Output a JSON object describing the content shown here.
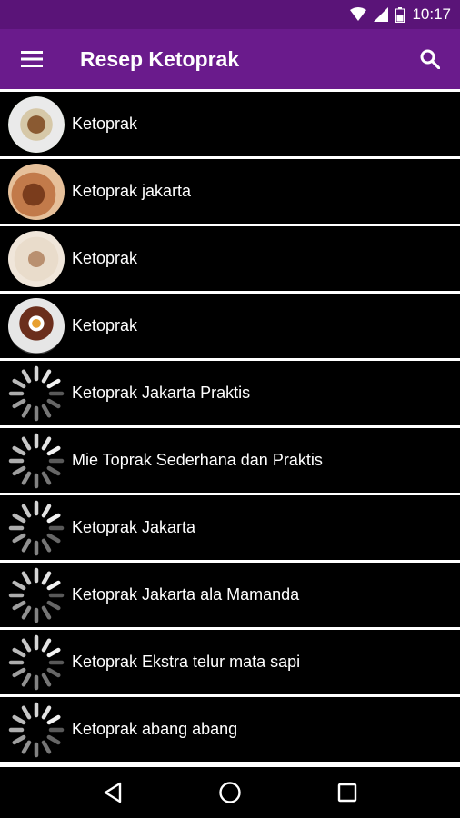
{
  "status_bar": {
    "time": "10:17",
    "icons": [
      "wifi-icon",
      "signal-icon",
      "battery-icon"
    ]
  },
  "app_bar": {
    "title": "Resep Ketoprak",
    "menu_icon": "hamburger-menu-icon",
    "search_icon": "search-icon",
    "color": "#6a1b8c",
    "status_color": "#5a1478"
  },
  "recipes": [
    {
      "label": "Ketoprak",
      "thumbnail": "food-image"
    },
    {
      "label": "Ketoprak jakarta",
      "thumbnail": "food-image"
    },
    {
      "label": "Ketoprak",
      "thumbnail": "food-image"
    },
    {
      "label": "Ketoprak",
      "thumbnail": "food-image"
    },
    {
      "label": "Ketoprak Jakarta Praktis",
      "thumbnail": "loading-spinner"
    },
    {
      "label": "Mie Toprak Sederhana dan Praktis",
      "thumbnail": "loading-spinner"
    },
    {
      "label": "Ketoprak Jakarta",
      "thumbnail": "loading-spinner"
    },
    {
      "label": "Ketoprak Jakarta ala Mamanda",
      "thumbnail": "loading-spinner"
    },
    {
      "label": "Ketoprak Ekstra telur mata sapi",
      "thumbnail": "loading-spinner"
    },
    {
      "label": "Ketoprak abang abang",
      "thumbnail": "loading-spinner"
    }
  ],
  "nav_bar": {
    "buttons": [
      "back-icon",
      "home-icon",
      "recents-icon"
    ]
  }
}
